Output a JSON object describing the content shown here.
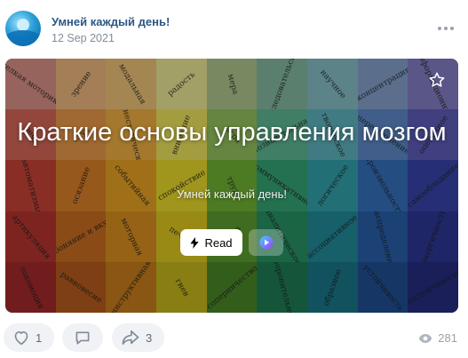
{
  "post": {
    "community_name": "Умней каждый день!",
    "date": "12 Sep 2021"
  },
  "cover": {
    "title": "Краткие основы управления мозгом",
    "subtitle": "Умней каждый день!",
    "read_label": "Read",
    "bookmark_icon": "star-icon",
    "grid_words": [
      [
        "мелкая моторика",
        "зрение",
        "модальная",
        "радость",
        "мера",
        "исследовательская",
        "научное",
        "концентрация",
        "информационная"
      ],
      [
        "речь",
        "слух",
        "кинестетическая",
        "внимание",
        "игра",
        "познавательная",
        "творческое",
        "переключение",
        "оценочное"
      ],
      [
        "автоматизмы",
        "осязание",
        "событийная",
        "спокойствие",
        "труд",
        "коммуникативное",
        "логическое",
        "произвольность",
        "самообладание"
      ],
      [
        "артикуляция",
        "обоняние и вкус",
        "моторная",
        "печаль",
        "учеба",
        "аналитическое",
        "ассоциативное",
        "распределение",
        "энергичность"
      ],
      [
        "локомоция",
        "равновесие",
        "инструктивная",
        "гнев",
        "соперничество",
        "оборонительное",
        "образное",
        "устойчивость",
        "настойчивость"
      ]
    ],
    "palette": [
      [
        "#b87a72",
        "#c79a6a",
        "#c9a466",
        "#c6c27e",
        "#93a877",
        "#6f9c88",
        "#6fa0a6",
        "#6f88ad",
        "#6e6aa6"
      ],
      [
        "#b4574a",
        "#c4803f",
        "#c89338",
        "#c8c04f",
        "#7da34f",
        "#4f9a7d",
        "#4f97a0",
        "#4f73a8",
        "#4f4f9e"
      ],
      [
        "#a8392e",
        "#b96c22",
        "#c2891d",
        "#c4b624",
        "#5f962d",
        "#2c8a62",
        "#2a8890",
        "#2d5e9e",
        "#2f3a8f"
      ],
      [
        "#9a2c28",
        "#a95c1c",
        "#b8781a",
        "#bba91b",
        "#4d8428",
        "#217a54",
        "#1d7580",
        "#22508f",
        "#262f7f"
      ],
      [
        "#8a2424",
        "#994e18",
        "#a86a18",
        "#a89a18",
        "#3f7222",
        "#1a6a48",
        "#176573",
        "#1c437d",
        "#20276e"
      ]
    ]
  },
  "footer": {
    "likes": "1",
    "reposts": "3",
    "views": "281"
  }
}
